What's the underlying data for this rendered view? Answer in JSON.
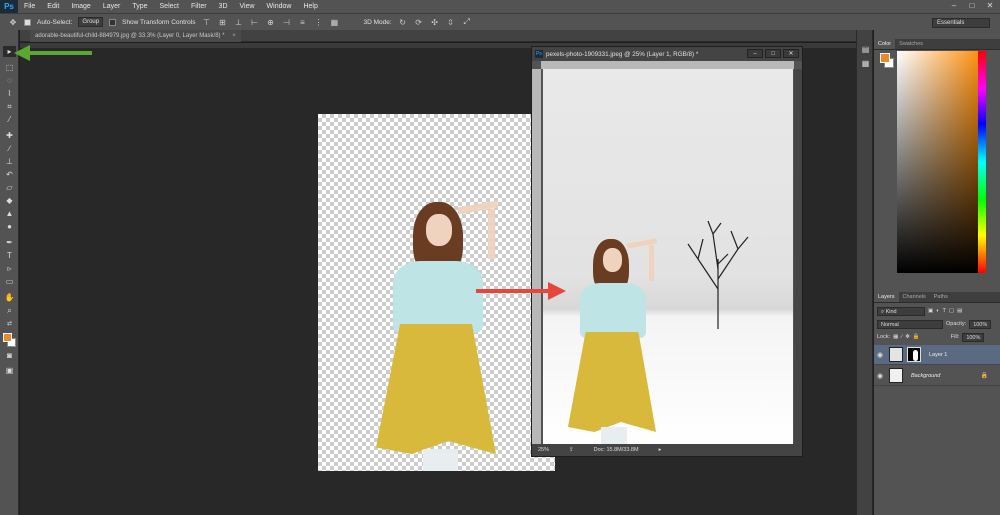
{
  "menubar": {
    "logo": "Ps",
    "items": [
      "File",
      "Edit",
      "Image",
      "Layer",
      "Type",
      "Select",
      "Filter",
      "3D",
      "View",
      "Window",
      "Help"
    ],
    "window_controls": [
      "–",
      "□",
      "✕"
    ]
  },
  "optionsbar": {
    "auto_select_label": "Auto-Select:",
    "auto_select_value": "Group",
    "show_transform_label": "Show Transform Controls",
    "mode_3d_label": "3D Mode:",
    "workspace": "Essentials"
  },
  "doc_tab": {
    "title": "adorable-beautiful-child-884979.jpg @ 33.3% (Layer 0, Layer Mask/8) *",
    "close": "×"
  },
  "float_window": {
    "title": "pexels-photo-1909331.jpeg @ 25% (Layer 1, RGB/8) *",
    "zoom": "25%",
    "doc_size": "Doc: 15.8M/33.8M",
    "buttons": [
      "–",
      "□",
      "✕"
    ]
  },
  "color_panel": {
    "tabs": [
      "Color",
      "Swatches"
    ],
    "foreground": "#ea8a2a",
    "background": "#ffffff"
  },
  "layers_panel": {
    "tabs": [
      "Layers",
      "Channels",
      "Paths"
    ],
    "filter_label": "Kind",
    "blend_mode": "Normal",
    "opacity_label": "Opacity:",
    "opacity_value": "100%",
    "lock_label": "Lock:",
    "fill_label": "Fill:",
    "fill_value": "100%",
    "layers": [
      {
        "name": "Layer 1",
        "selected": true
      },
      {
        "name": "Background",
        "selected": false
      }
    ]
  },
  "colors": {
    "annotation_green": "#5aa832",
    "annotation_red": "#e8453c"
  }
}
